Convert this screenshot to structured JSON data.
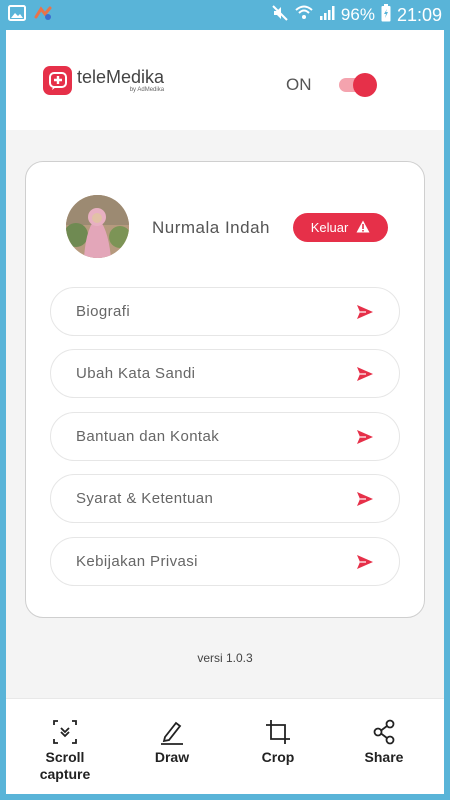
{
  "status_bar": {
    "battery": "96%",
    "time": "21:09"
  },
  "header": {
    "logo_name": "teleMedika",
    "logo_sub": "by AdMedika",
    "toggle_label": "ON",
    "toggle_on": true
  },
  "profile": {
    "name": "Nurmala Indah",
    "logout_label": "Keluar"
  },
  "menu": {
    "items": [
      {
        "label": "Biografi"
      },
      {
        "label": "Ubah Kata Sandi"
      },
      {
        "label": "Bantuan dan Kontak"
      },
      {
        "label": "Syarat & Ketentuan"
      },
      {
        "label": "Kebijakan Privasi"
      }
    ]
  },
  "version": "versi 1.0.3",
  "toolbar": {
    "scroll_capture_line1": "Scroll",
    "scroll_capture_line2": "capture",
    "draw": "Draw",
    "crop": "Crop",
    "share": "Share"
  },
  "colors": {
    "accent": "#e63049",
    "status_bar": "#59b4d8"
  },
  "icons": {
    "gallery": "image-icon",
    "app": "app-icon",
    "mute": "mute-icon",
    "wifi": "wifi-icon",
    "signal": "signal-icon",
    "battery": "battery-icon",
    "warning": "warning-icon",
    "send": "send-arrow-icon",
    "scroll_capture": "scroll-capture-icon",
    "draw": "pencil-icon",
    "crop": "crop-icon",
    "share": "share-icon"
  }
}
